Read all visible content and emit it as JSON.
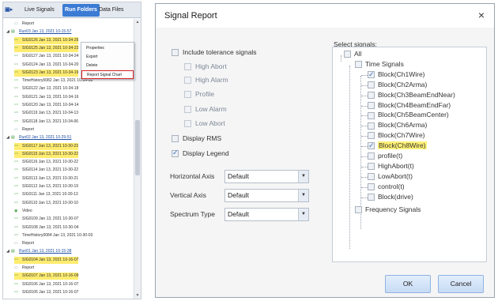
{
  "left_panel": {
    "tabs": [
      "Live Signals",
      "Run Folders",
      "Data Files"
    ],
    "rows": [
      {
        "label": "Report",
        "type": "doc",
        "indent": 1
      },
      {
        "label": "Run03 Jan 13, 2021 10-15-57",
        "type": "run",
        "indent": 0
      },
      {
        "label": "SIG0126 Jan 13, 2021 10-34-26",
        "type": "sig",
        "indent": 1,
        "hl": true
      },
      {
        "label": "SIG0125 Jan 13, 2021 10-34-22",
        "type": "sig",
        "indent": 1,
        "hl": true
      },
      {
        "label": "SIG0127 Jan 13, 2021 10-34-24",
        "type": "sig",
        "indent": 1
      },
      {
        "label": "SIG0124 Jan 13, 2021 10-34-20",
        "type": "sig",
        "indent": 1
      },
      {
        "label": "SIG0123 Jan 13, 2021 10-34-19",
        "type": "sig",
        "indent": 1,
        "hl": true
      },
      {
        "label": "TimeHistory0082 Jan 13, 2021 10-34-08",
        "type": "sig",
        "indent": 1
      },
      {
        "label": "SIG0122 Jan 13, 2021 10-34-18",
        "type": "sig",
        "indent": 1
      },
      {
        "label": "SIG0121 Jan 13, 2021 10-34-16",
        "type": "sig",
        "indent": 1
      },
      {
        "label": "SIG0120 Jan 13, 2021 10-34-14",
        "type": "sig",
        "indent": 1
      },
      {
        "label": "SIG0119 Jan 13, 2021 10-34-13",
        "type": "sig",
        "indent": 1
      },
      {
        "label": "SIG0118 Jan 13, 2021 10-34-06",
        "type": "sig",
        "indent": 1
      },
      {
        "label": "Report",
        "type": "doc",
        "indent": 1
      },
      {
        "label": "Run02 Jan 13, 2021 10-29-51",
        "type": "run",
        "indent": 0
      },
      {
        "label": "SIG0117 Jan 13, 2021 10-30-23",
        "type": "sig",
        "indent": 1,
        "hl": true
      },
      {
        "label": "SIG0115 Jan 13, 2021 10-30-22",
        "type": "sig",
        "indent": 1,
        "hl": true
      },
      {
        "label": "SIG0116 Jan 13, 2021 10-30-22",
        "type": "sig",
        "indent": 1
      },
      {
        "label": "SIG0114 Jan 13, 2021 10-30-22",
        "type": "sig",
        "indent": 1
      },
      {
        "label": "SIG0113 Jan 13, 2021 10-30-21",
        "type": "sig",
        "indent": 1
      },
      {
        "label": "SIG0112 Jan 13, 2021 10-30-19",
        "type": "sig",
        "indent": 1
      },
      {
        "label": "SIG0111 Jan 13, 2021 10-30-13",
        "type": "sig",
        "indent": 1
      },
      {
        "label": "SIG0110 Jan 13, 2021 10-30-10",
        "type": "sig",
        "indent": 1
      },
      {
        "label": "Video",
        "type": "video",
        "indent": 1
      },
      {
        "label": "SIG0109 Jan 13, 2021 10-30-07",
        "type": "sig",
        "indent": 1
      },
      {
        "label": "SIG0108 Jan 13, 2021 10-30-04",
        "type": "sig",
        "indent": 1
      },
      {
        "label": "TimeHistory0084 Jan 13, 2021 10-30-03",
        "type": "sig",
        "indent": 1
      },
      {
        "label": "Report",
        "type": "doc",
        "indent": 1
      },
      {
        "label": "Run01 Jan 13, 2021 10-15-38",
        "type": "run",
        "indent": 0
      },
      {
        "label": "SIG0104 Jan 13, 2021 10-16-07",
        "type": "sig",
        "indent": 1,
        "hl": true
      },
      {
        "label": "Report",
        "type": "doc",
        "indent": 1
      },
      {
        "label": "SIG0107 Jan 13, 2021 10-16-09",
        "type": "sig",
        "indent": 1,
        "hl": true
      },
      {
        "label": "SIG0106 Jan 13, 2021 10-16-07",
        "type": "sig",
        "indent": 1
      },
      {
        "label": "SIG0105 Jan 13, 2021 10-16-07",
        "type": "sig",
        "indent": 1
      }
    ],
    "context_menu": [
      "Properties",
      "Export",
      "Delete",
      "Report Signal Chart"
    ]
  },
  "dialog": {
    "title": "Signal Report",
    "close": "×",
    "options": [
      {
        "label": "Include tolerance signals",
        "checked": false,
        "sub": false
      },
      {
        "label": "High Abort",
        "checked": false,
        "sub": true
      },
      {
        "label": "High Alarm",
        "checked": false,
        "sub": true
      },
      {
        "label": "Profile",
        "checked": false,
        "sub": true
      },
      {
        "label": "Low Alarm",
        "checked": false,
        "sub": true
      },
      {
        "label": "Low Abort",
        "checked": false,
        "sub": true
      },
      {
        "label": "Display RMS",
        "checked": false,
        "sub": false
      },
      {
        "label": "Display Legend",
        "checked": true,
        "sub": false
      }
    ],
    "fields": [
      {
        "label": "Horizontal Axis",
        "value": "Default"
      },
      {
        "label": "Vertical Axis",
        "value": "Default"
      },
      {
        "label": "Spectrum Type",
        "value": "Default"
      }
    ],
    "select_signals_label": "Select signals:",
    "tree": [
      {
        "label": "All",
        "level": 0,
        "checked": false
      },
      {
        "label": "Time Signals",
        "level": 1,
        "checked": false
      },
      {
        "label": "Block(Ch1Wire)",
        "level": 2,
        "checked": true
      },
      {
        "label": "Block(Ch2Arma)",
        "level": 2,
        "checked": false
      },
      {
        "label": "Block(Ch3BeamEndNear)",
        "level": 2,
        "checked": false
      },
      {
        "label": "Block(Ch4BeamEndFar)",
        "level": 2,
        "checked": false
      },
      {
        "label": "Block(Ch5BeamCenter)",
        "level": 2,
        "checked": false
      },
      {
        "label": "Block(Ch6Arma)",
        "level": 2,
        "checked": false
      },
      {
        "label": "Block(Ch7Wire)",
        "level": 2,
        "checked": false
      },
      {
        "label": "Block(Ch8Wire)",
        "level": 2,
        "checked": true,
        "hl": true
      },
      {
        "label": "profile(t)",
        "level": 2,
        "checked": false
      },
      {
        "label": "HighAbort(t)",
        "level": 2,
        "checked": false
      },
      {
        "label": "LowAbort(t)",
        "level": 2,
        "checked": false
      },
      {
        "label": "control(t)",
        "level": 2,
        "checked": false
      },
      {
        "label": "Block(drive)",
        "level": 2,
        "checked": false
      },
      {
        "label": "Frequency Signals",
        "level": 1,
        "checked": false
      }
    ],
    "ok_label": "OK",
    "cancel_label": "Cancel"
  }
}
